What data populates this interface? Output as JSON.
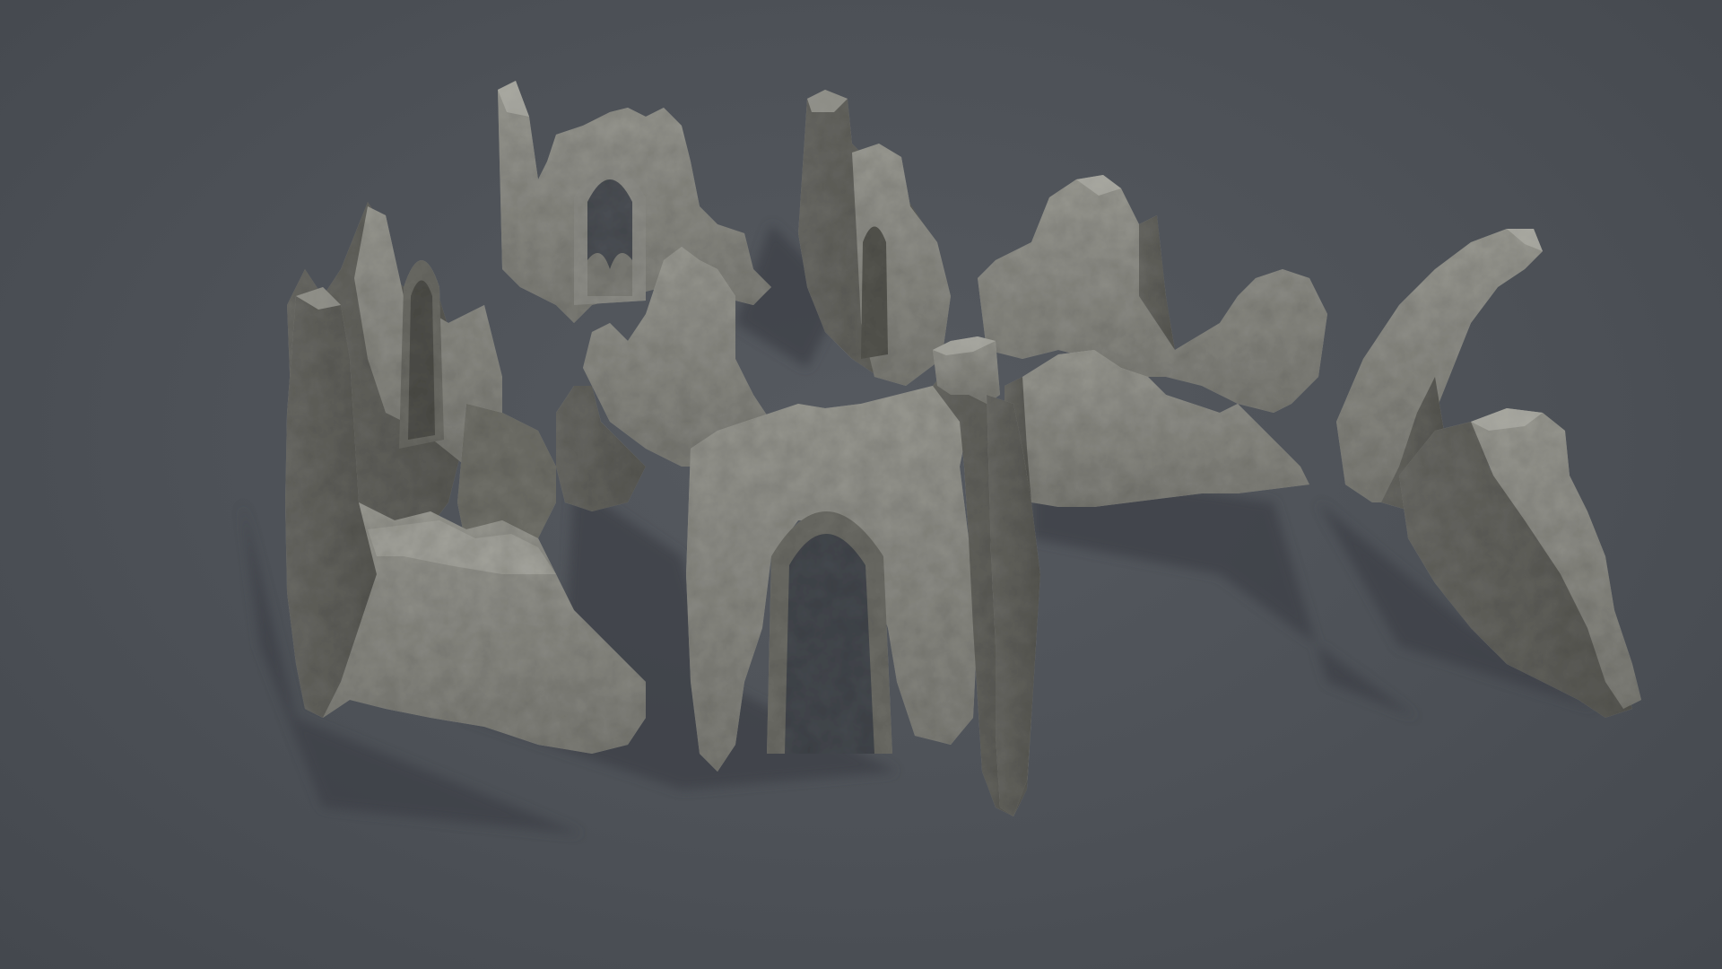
{
  "scene": {
    "subject": "",
    "background_color": "#4b4f55",
    "stone_color": "#8a8a84",
    "stone_shade_color": "#5e5e59",
    "stone_highlight_color": "#a9a9a2",
    "shadow_color": "#3d4146"
  }
}
